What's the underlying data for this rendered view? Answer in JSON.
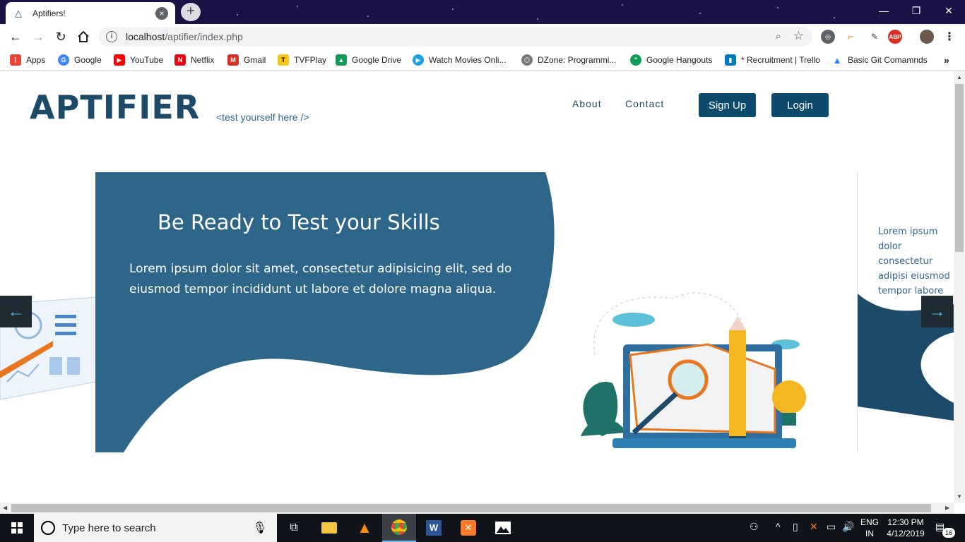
{
  "browser": {
    "tab_title": "Aptifiers!",
    "url_host": "localhost",
    "url_path": "/aptifier/index.php"
  },
  "bookmarks": [
    {
      "label": "Apps",
      "icon": "apps-grid-icon",
      "color": "#ea4335"
    },
    {
      "label": "Google",
      "icon": "google-icon",
      "color": "#4285f4"
    },
    {
      "label": "YouTube",
      "icon": "youtube-icon",
      "color": "#ff0000"
    },
    {
      "label": "Netflix",
      "icon": "netflix-icon",
      "color": "#e50914"
    },
    {
      "label": "Gmail",
      "icon": "gmail-icon",
      "color": "#d93025"
    },
    {
      "label": "TVFPlay",
      "icon": "tvfplay-icon",
      "color": "#f5c518"
    },
    {
      "label": "Google Drive",
      "icon": "google-drive-icon",
      "color": "#0f9d58"
    },
    {
      "label": "Watch Movies Onli...",
      "icon": "play-icon",
      "color": "#1aa3e0"
    },
    {
      "label": "DZone: Programmi...",
      "icon": "dzone-icon",
      "color": "#7a7a7a"
    },
    {
      "label": "Google Hangouts",
      "icon": "hangouts-icon",
      "color": "#0f9d58"
    },
    {
      "label": "* Recruitment | Trello",
      "icon": "trello-icon",
      "color": "#0079bf"
    },
    {
      "label": "Basic Git Comamnds",
      "icon": "atlassian-icon",
      "color": "#2684ff"
    }
  ],
  "page": {
    "logo": "APTIFIER",
    "tagline": "<test yourself here />",
    "nav": {
      "about": "About",
      "contact": "Contact",
      "signup": "Sign Up",
      "login": "Login"
    },
    "slide": {
      "title": "Be Ready to Test your Skills",
      "text": "Lorem ipsum dolor sit amet, consectetur adipisicing elit, sed do eiusmod tempor incididunt ut labore et dolore magna aliqua.",
      "next_text": "Lorem ipsum dolor consectetur adipisi eiusmod tempor labore et dolore m"
    },
    "colors": {
      "brand": "#1d4a69",
      "slide_bg": "#2e6689",
      "accent": "#f5a623"
    }
  },
  "taskbar": {
    "search_placeholder": "Type here to search",
    "lang_line1": "ENG",
    "lang_line2": "IN",
    "time": "12:30 PM",
    "date": "4/12/2019",
    "notifications": "16"
  }
}
